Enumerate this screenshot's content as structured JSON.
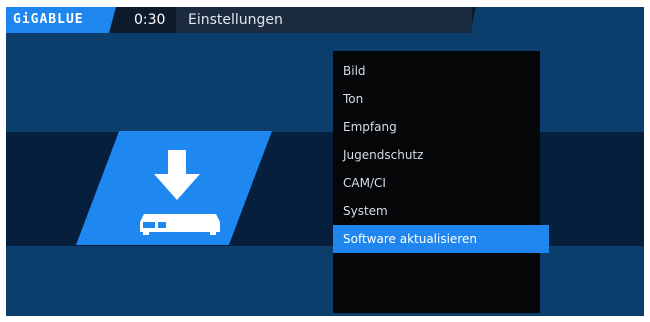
{
  "header": {
    "logo_text": "GiGABLUE",
    "clock": "0:30",
    "title": "Einstellungen"
  },
  "tile": {
    "icon": "software-update-download-icon"
  },
  "menu": {
    "items": [
      {
        "label": "Bild",
        "selected": false
      },
      {
        "label": "Ton",
        "selected": false
      },
      {
        "label": "Empfang",
        "selected": false
      },
      {
        "label": "Jugendschutz",
        "selected": false
      },
      {
        "label": "CAM/CI",
        "selected": false
      },
      {
        "label": "System",
        "selected": false
      },
      {
        "label": "Software aktualisieren",
        "selected": true
      }
    ]
  },
  "colors": {
    "background": "#0c3e6d",
    "band": "#061f3c",
    "accent": "#1e88f0",
    "menu_bg": "#050607"
  }
}
